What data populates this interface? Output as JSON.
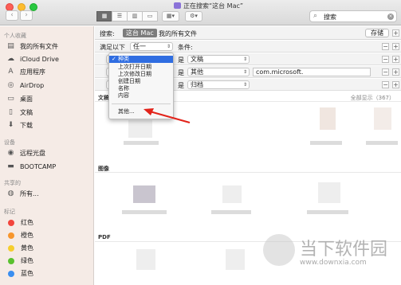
{
  "window": {
    "title": "正在搜索“这台 Mac”"
  },
  "toolbar": {
    "view_icons": [
      "▦",
      "☰",
      "▥",
      "▭"
    ],
    "arrange_icon": "▦▾",
    "action_icon": "⚙▾",
    "search_value": "搜索",
    "search_icon": "search-icon"
  },
  "sidebar": {
    "favorites_title": "个人收藏",
    "favorites": [
      {
        "label": "我的所有文件",
        "icon": "all-files-icon",
        "glyph": "▤"
      },
      {
        "label": "iCloud Drive",
        "icon": "cloud-icon",
        "glyph": "☁"
      },
      {
        "label": "应用程序",
        "icon": "applications-icon",
        "glyph": "A"
      },
      {
        "label": "AirDrop",
        "icon": "airdrop-icon",
        "glyph": "◎"
      },
      {
        "label": "桌面",
        "icon": "desktop-icon",
        "glyph": "▭"
      },
      {
        "label": "文稿",
        "icon": "documents-icon",
        "glyph": "▯"
      },
      {
        "label": "下载",
        "icon": "downloads-icon",
        "glyph": "⬇"
      }
    ],
    "devices_title": "设备",
    "devices": [
      {
        "label": "远程光盘",
        "icon": "remote-disc-icon",
        "glyph": "◉"
      },
      {
        "label": "BOOTCAMP",
        "icon": "disk-icon",
        "glyph": "▬"
      }
    ],
    "shared_title": "共享的",
    "shared": [
      {
        "label": "所有...",
        "icon": "network-icon",
        "glyph": "◍"
      }
    ],
    "tags_title": "标记",
    "tags": [
      {
        "label": "红色",
        "color": "#f2453d"
      },
      {
        "label": "橙色",
        "color": "#f7962d"
      },
      {
        "label": "黄色",
        "color": "#f5ce2e"
      },
      {
        "label": "绿色",
        "color": "#5ac12f"
      },
      {
        "label": "蓝色",
        "color": "#3a8ef0"
      }
    ]
  },
  "search_bar": {
    "label": "搜索:",
    "scope_active": "这台 Mac",
    "scope_other": "我的所有文件",
    "save": "存储"
  },
  "criteria": {
    "row1": {
      "match": "满足以下",
      "any": "任一",
      "cond": "条件:"
    },
    "row2": {
      "is": "是",
      "value": "文稿"
    },
    "row3": {
      "is": "是",
      "value": "其他",
      "text": "com.microsoft."
    },
    "row4": {
      "is": "是",
      "value": "归档"
    }
  },
  "results": {
    "doc_header": "文稿",
    "show_all": "全部显示（367）",
    "images_header": "图像",
    "pdf_header": "PDF"
  },
  "dropdown": {
    "items": [
      "✓ 种类",
      "上次打开日期",
      "上次修改日期",
      "创建日期",
      "名称",
      "内容"
    ],
    "other": "其他..."
  },
  "watermark": {
    "text": "当下软件园",
    "url": "www.downxia.com"
  }
}
